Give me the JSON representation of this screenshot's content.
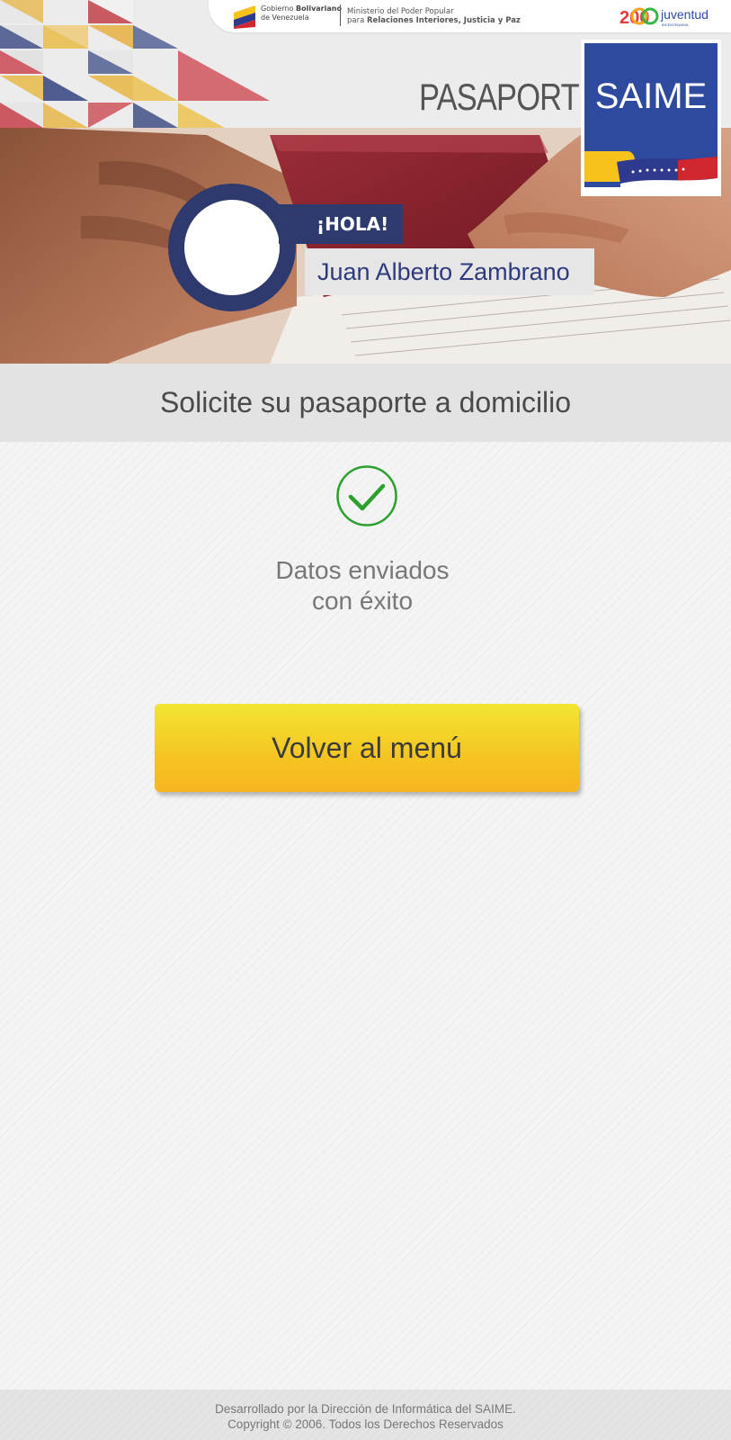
{
  "header": {
    "gov_line1_prefix": "Gobierno ",
    "gov_line1_bold": "Bolivariano",
    "gov_line2": "de Venezuela",
    "ministry_line1": "Ministerio del Poder Popular",
    "ministry_line2_prefix": "para ",
    "ministry_line2_bold": "Relaciones Interiores, Justicia y Paz",
    "section_title": "PASAPORTE",
    "saime_logo_text": "SAIME",
    "juventud_text": "juventud",
    "juventud_sub": "BICENTENARIA",
    "juventud_number": "200"
  },
  "greeting": {
    "hello": "¡HOLA!",
    "user_name": "Juan Alberto Zambrano"
  },
  "page": {
    "title": "Solicite su pasaporte a domicilio"
  },
  "status": {
    "line1": "Datos enviados",
    "line2": "con éxito",
    "icon": "check-circle-icon",
    "color": "#2ca02c"
  },
  "actions": {
    "back_to_menu": "Volver al menú"
  },
  "footer": {
    "line1": "Desarrollado por la Dirección de Informática del SAIME.",
    "line2": "Copyright © 2006. Todos los Derechos Reservados"
  },
  "colors": {
    "brand_navy": "#2e3a6e",
    "button_yellow": "#f5c523",
    "saime_blue": "#2e4a9e",
    "flag_yellow": "#f7c21c",
    "flag_red": "#d0262e"
  }
}
